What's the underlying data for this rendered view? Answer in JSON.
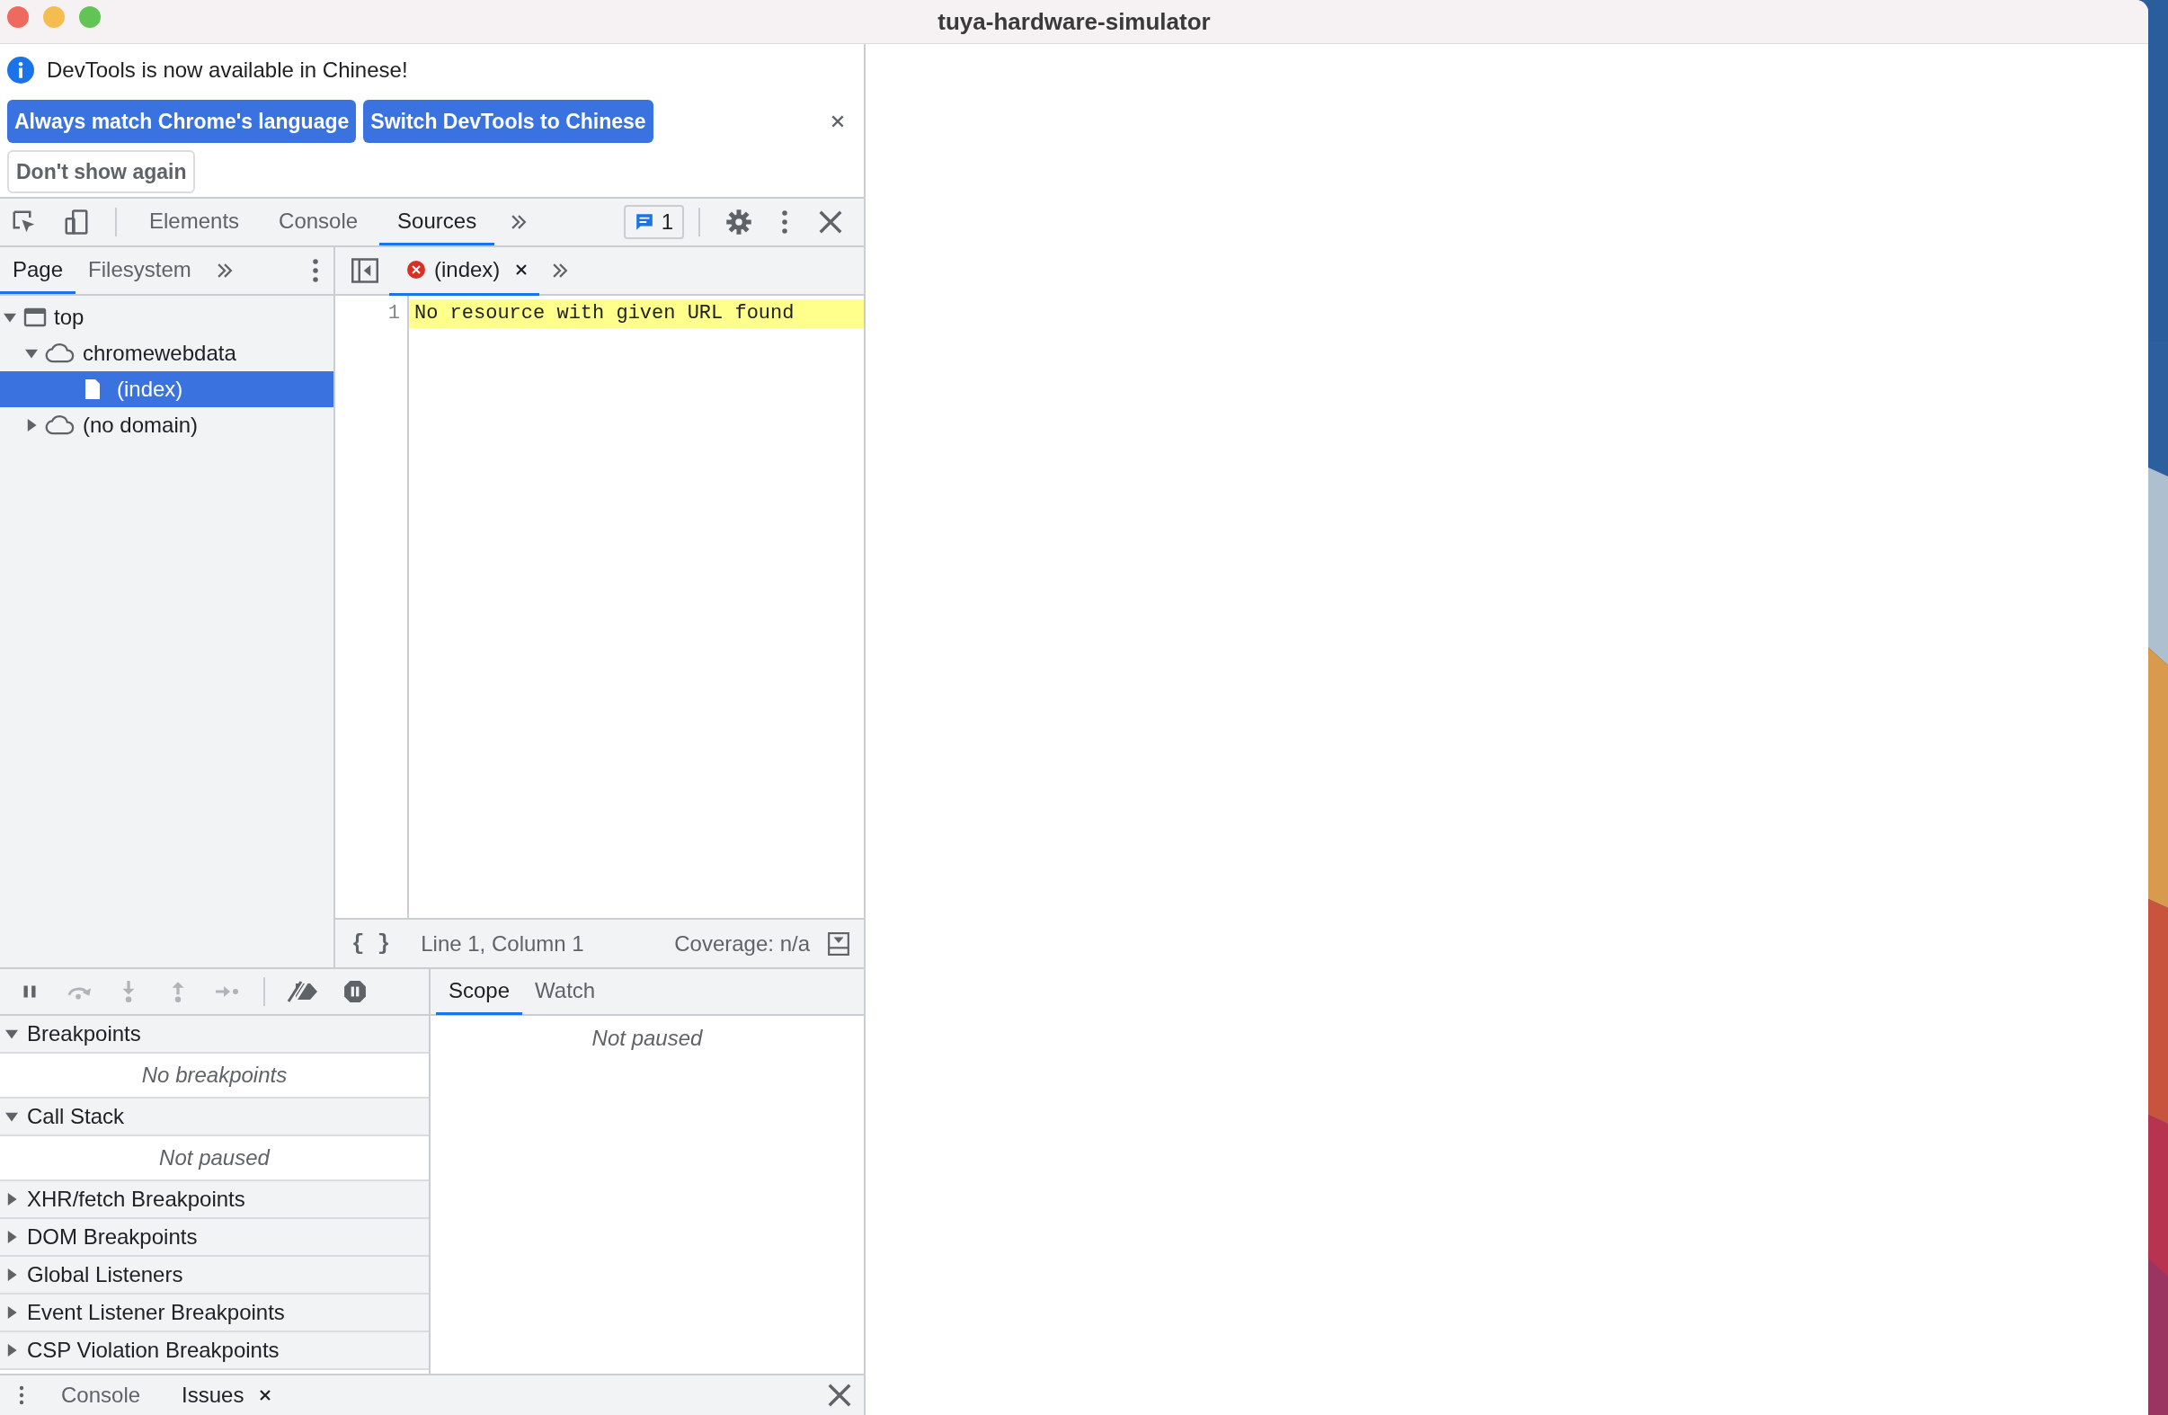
{
  "window": {
    "title": "tuya-hardware-simulator"
  },
  "infobar": {
    "message": "DevTools is now available in Chinese!",
    "buttons": [
      {
        "label": "Always match Chrome's language",
        "kind": "primary"
      },
      {
        "label": "Switch DevTools to Chinese",
        "kind": "primary"
      },
      {
        "label": "Don't show again",
        "kind": "secondary"
      }
    ]
  },
  "main_tabs": [
    {
      "label": "Elements",
      "selected": false
    },
    {
      "label": "Console",
      "selected": false
    },
    {
      "label": "Sources",
      "selected": true
    }
  ],
  "issues_count": "1",
  "navigator": {
    "tabs": [
      {
        "label": "Page",
        "selected": true
      },
      {
        "label": "Filesystem",
        "selected": false
      }
    ],
    "tree": [
      {
        "label": "top",
        "kind": "frame",
        "expanded": true,
        "selected": false,
        "children": [
          {
            "label": "chromewebdata",
            "kind": "domain",
            "expanded": true,
            "selected": false,
            "children": [
              {
                "label": "(index)",
                "kind": "file",
                "selected": true
              }
            ]
          },
          {
            "label": "(no domain)",
            "kind": "domain",
            "expanded": false,
            "selected": false
          }
        ]
      }
    ]
  },
  "editor": {
    "tabs": [
      {
        "label": "(index)",
        "selected": true,
        "error": true
      }
    ],
    "lines": [
      {
        "number": "1",
        "text": "No resource with given URL found",
        "highlighted": true
      }
    ],
    "status": {
      "pretty_print": "{ }",
      "position": "Line 1, Column 1",
      "coverage": "Coverage: n/a"
    }
  },
  "debugger": {
    "sections": [
      {
        "title": "Breakpoints",
        "expanded": true,
        "message": "No breakpoints"
      },
      {
        "title": "Call Stack",
        "expanded": true,
        "message": "Not paused"
      },
      {
        "title": "XHR/fetch Breakpoints",
        "expanded": false
      },
      {
        "title": "DOM Breakpoints",
        "expanded": false
      },
      {
        "title": "Global Listeners",
        "expanded": false
      },
      {
        "title": "Event Listener Breakpoints",
        "expanded": false
      },
      {
        "title": "CSP Violation Breakpoints",
        "expanded": false
      }
    ],
    "side_tabs": [
      {
        "label": "Scope",
        "selected": true
      },
      {
        "label": "Watch",
        "selected": false
      }
    ],
    "side_message": "Not paused"
  },
  "drawer": {
    "tabs": [
      {
        "label": "Console",
        "selected": false,
        "closable": false
      },
      {
        "label": "Issues",
        "selected": true,
        "closable": true
      }
    ]
  }
}
